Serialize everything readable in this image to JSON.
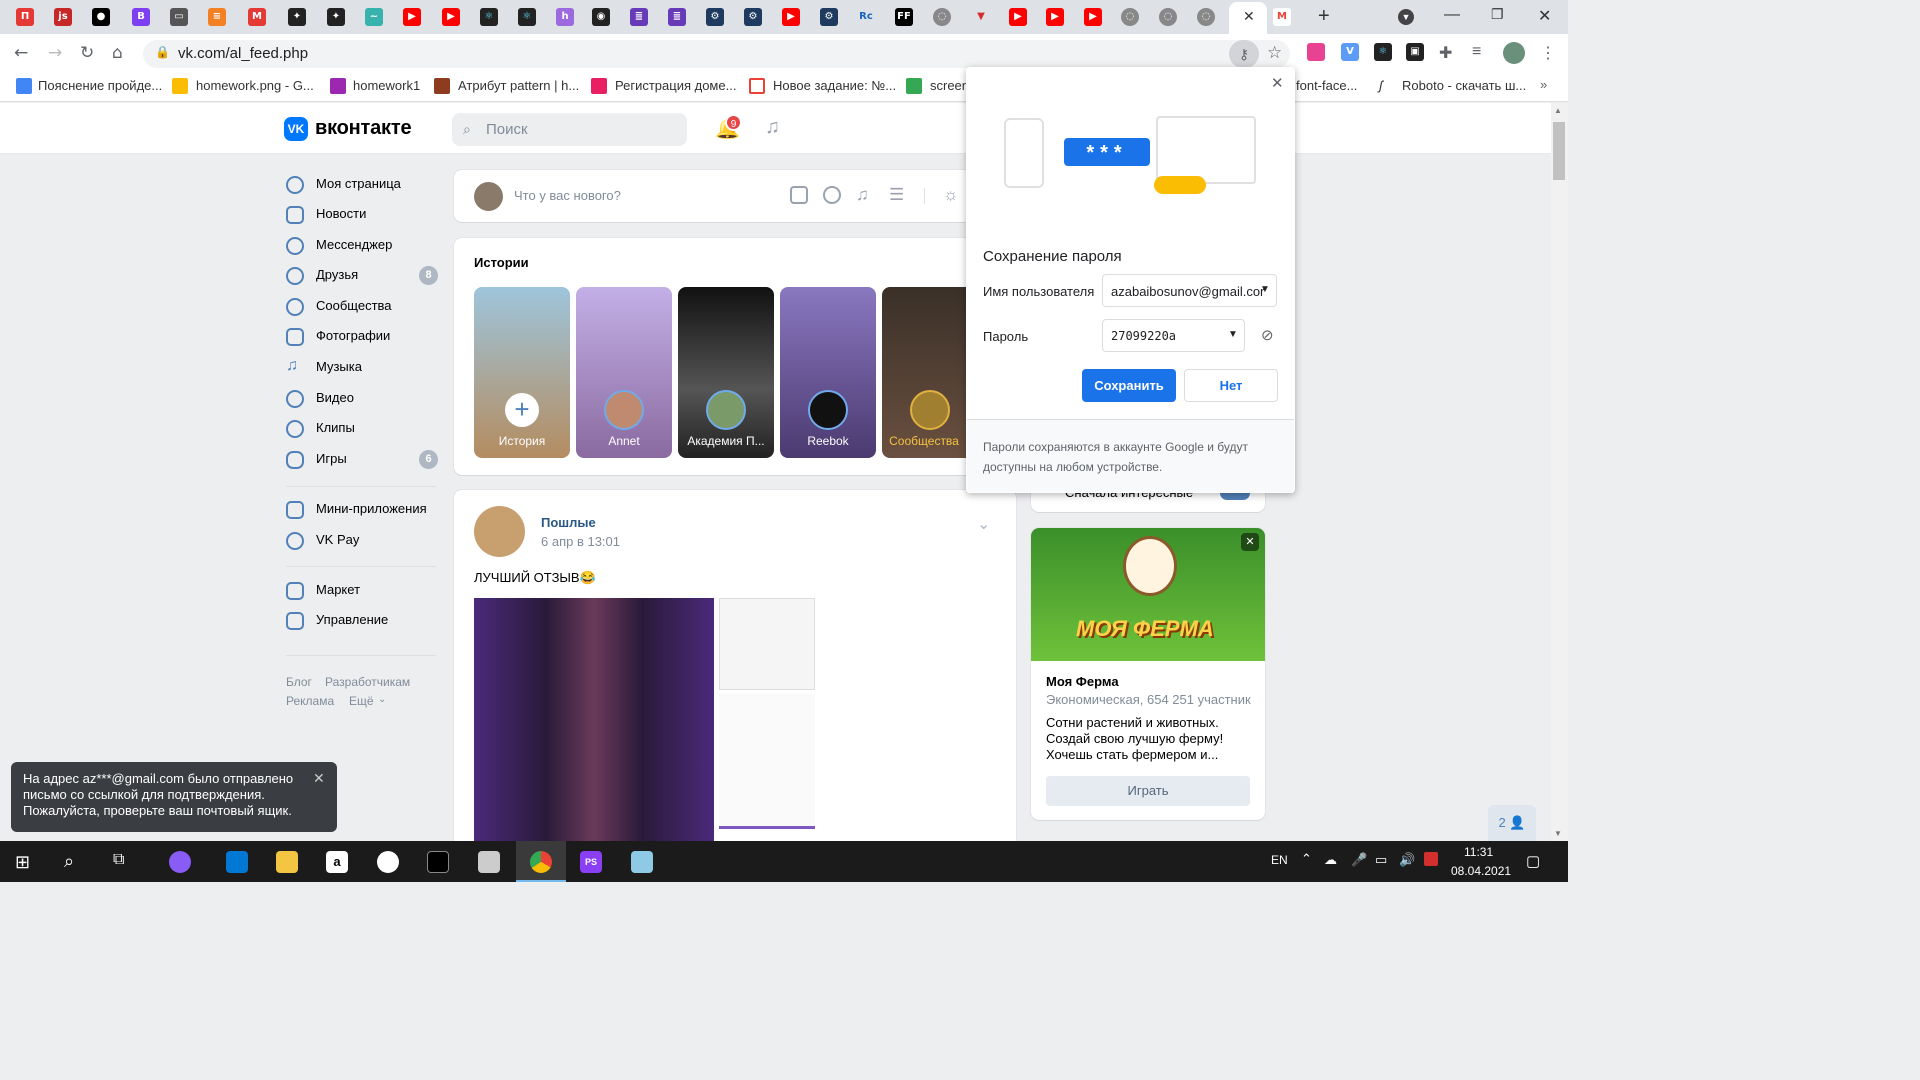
{
  "browser": {
    "url": "vk.com/al_feed.php",
    "tab_favicons": [
      "pi",
      "js",
      "medium",
      "bootstrap",
      "tab",
      "stackoverflow",
      "m",
      "bird",
      "bird",
      "wave",
      "youtube",
      "youtube",
      "react",
      "react",
      "hexo",
      "github",
      "forms",
      "forms",
      "gear",
      "gear",
      "youtube",
      "gear",
      "rc",
      "ff",
      "globe",
      "arrow",
      "youtube",
      "youtube",
      "youtube",
      "globe",
      "globe",
      "globe",
      "active",
      "gmail"
    ],
    "bookmarks": [
      {
        "label": "Пояснение пройде..."
      },
      {
        "label": "homework.png - G..."
      },
      {
        "label": "homework1"
      },
      {
        "label": "Атрибут pattern | h..."
      },
      {
        "label": "Регистрация доме..."
      },
      {
        "label": "Новое задание: №..."
      },
      {
        "label": "screen"
      },
      {
        "label": "font-face..."
      },
      {
        "label": "Roboto - скачать ш..."
      }
    ]
  },
  "vk": {
    "brand": "вконтакте",
    "search_placeholder": "Поиск",
    "notifications_count": "9",
    "menu": [
      {
        "label": "Моя страница",
        "count": ""
      },
      {
        "label": "Новости",
        "count": ""
      },
      {
        "label": "Мессенджер",
        "count": ""
      },
      {
        "label": "Друзья",
        "count": "8"
      },
      {
        "label": "Сообщества",
        "count": ""
      },
      {
        "label": "Фотографии",
        "count": ""
      },
      {
        "label": "Музыка",
        "count": ""
      },
      {
        "label": "Видео",
        "count": ""
      },
      {
        "label": "Клипы",
        "count": ""
      },
      {
        "label": "Игры",
        "count": "6"
      }
    ],
    "menu2": [
      {
        "label": "Мини-приложения"
      },
      {
        "label": "VK Pay"
      }
    ],
    "menu3": [
      {
        "label": "Маркет"
      },
      {
        "label": "Управление"
      }
    ],
    "footer_links": {
      "blog": "Блог",
      "dev": "Разработчикам",
      "ads": "Реклама",
      "more": "Ещё"
    },
    "compose_placeholder": "Что у вас нового?",
    "stories_title": "Истории",
    "stories": [
      {
        "label": "История",
        "color": "#6b8fa6"
      },
      {
        "label": "Annet",
        "color": "#9a86c8"
      },
      {
        "label": "Академия П...",
        "color": "#222222"
      },
      {
        "label": "Reebok",
        "color": "#7a6aa8"
      },
      {
        "label": "Сообщества",
        "color": "#5a4a3a"
      }
    ],
    "post": {
      "author": "Пошлые",
      "date": "6 апр в 13:01",
      "text": "ЛУЧШИЙ ОТЗЫВ😂"
    },
    "feed_filter": "Сначала интересные",
    "ad": {
      "image_text": "МОЯ ФЕРМА",
      "title": "Моя Ферма",
      "subtitle": "Экономическая, 654 251 участник",
      "description": "Сотни растений и животных. Создай свою лучшую ферму! Хочешь стать фермером и...",
      "button": "Играть"
    },
    "friends_online": "2"
  },
  "password_dialog": {
    "title": "Сохранение пароля",
    "username_label": "Имя пользователя",
    "username_value": "azabaibosunov@gmail.cor",
    "password_label": "Пароль",
    "password_value": "27099220a",
    "save_button": "Сохранить",
    "no_button": "Нет",
    "footer": "Пароли сохраняются в аккаунте Google и будут доступны на любом устройстве.",
    "illustration_mask": "***"
  },
  "toast": {
    "text": "На адрес az***@gmail.com было отправлено письмо со ссылкой для подтверждения. Пожалуйста, проверьте ваш почтовый ящик."
  },
  "taskbar": {
    "lang": "EN",
    "time": "11:31",
    "date": "08.04.2021"
  },
  "colors": {
    "vk_blue": "#0077ff",
    "link": "#2a5885",
    "chrome_blue": "#1a73e8"
  }
}
